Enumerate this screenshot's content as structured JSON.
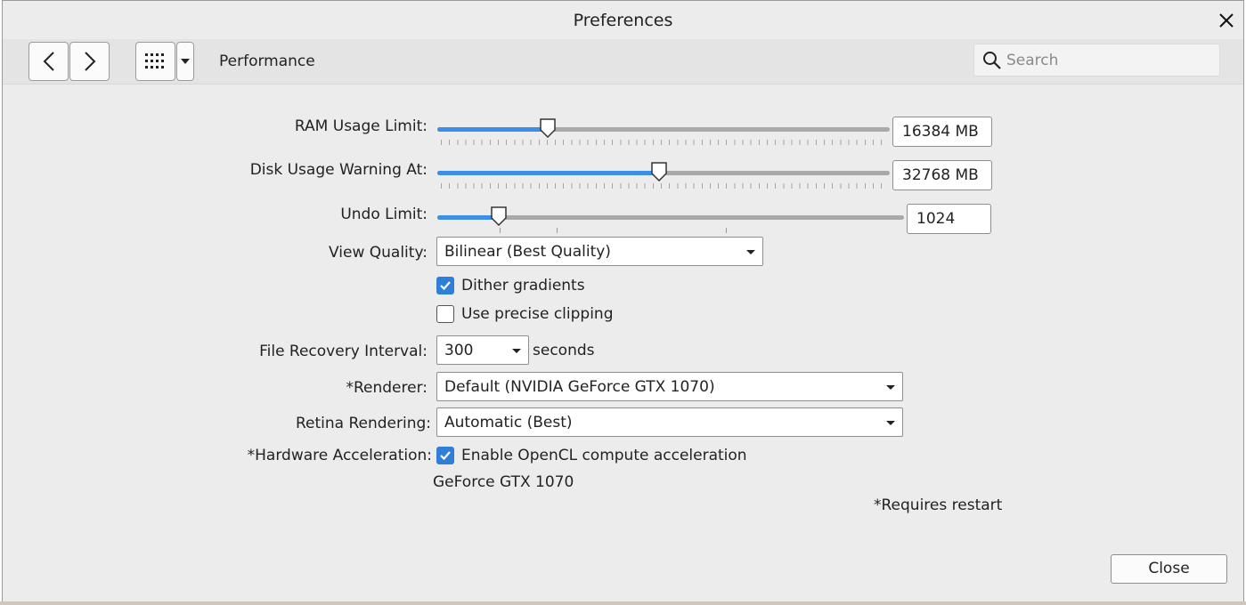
{
  "window": {
    "title": "Preferences"
  },
  "toolbar": {
    "back_glyph": "<",
    "forward_glyph": ">",
    "section_label": "Performance",
    "search": {
      "placeholder": "Search",
      "value": ""
    }
  },
  "settings": {
    "ram": {
      "label": "RAM Usage Limit:",
      "value": "16384 MB",
      "level": 0.245
    },
    "disk": {
      "label": "Disk Usage Warning At:",
      "value": "32768 MB",
      "level": 0.49
    },
    "undo": {
      "label": "Undo Limit:",
      "value": "1024",
      "level": 0.132
    },
    "view_quality": {
      "label": "View Quality:",
      "selected": "Bilinear (Best Quality)"
    },
    "dither": {
      "label": "Dither gradients",
      "checked": true
    },
    "precise_clipping": {
      "label": "Use precise clipping",
      "checked": false
    },
    "file_recovery": {
      "label": "File Recovery Interval:",
      "selected": "300",
      "unit": "seconds"
    },
    "renderer": {
      "label": "*Renderer:",
      "selected": "Default (NVIDIA GeForce GTX 1070)"
    },
    "retina": {
      "label": "Retina Rendering:",
      "selected": "Automatic (Best)"
    },
    "hardware_accel": {
      "label": "*Hardware Acceleration:",
      "option_label": "Enable OpenCL compute acceleration",
      "checked": true,
      "device": "GeForce GTX 1070"
    },
    "restart_note": "*Requires restart"
  },
  "footer": {
    "close_label": "Close"
  },
  "colors": {
    "accent": "#3c8ee7",
    "checkbox": "#2f7fd9",
    "track": "#a9a9a9",
    "window_bg": "#ececec"
  },
  "icons": [
    "close-icon",
    "back-arrow-icon",
    "forward-arrow-icon",
    "grid-icon",
    "chevron-down-icon",
    "search-icon",
    "slider-thumb-icon",
    "checkmark-icon"
  ]
}
